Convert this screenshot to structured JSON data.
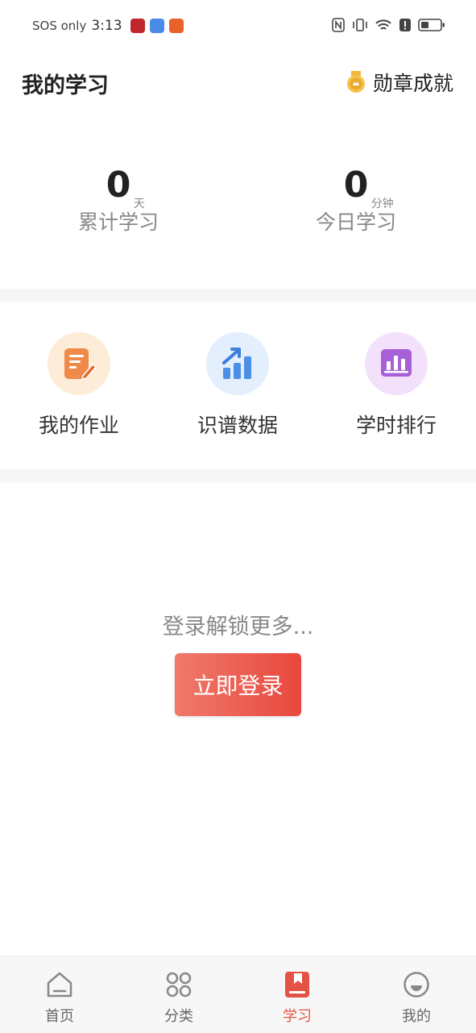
{
  "status_bar": {
    "carrier": "SOS only",
    "time": "3:13",
    "signal_icons": [
      "nfc-icon",
      "vibrate-icon",
      "wifi-icon",
      "alert-icon",
      "battery-icon"
    ]
  },
  "header": {
    "title": "我的学习",
    "badge_label": "勋章成就"
  },
  "stats": [
    {
      "value": "0",
      "unit": "天",
      "label": "累计学习"
    },
    {
      "value": "0",
      "unit": "分钟",
      "label": "今日学习"
    }
  ],
  "features": [
    {
      "label": "我的作业",
      "icon": "homework-icon"
    },
    {
      "label": "识谱数据",
      "icon": "chart-growth-icon"
    },
    {
      "label": "学时排行",
      "icon": "ranking-icon"
    }
  ],
  "login": {
    "hint": "登录解锁更多...",
    "button": "立即登录"
  },
  "tabbar": [
    {
      "label": "首页",
      "icon": "home-icon",
      "active": false
    },
    {
      "label": "分类",
      "icon": "category-icon",
      "active": false
    },
    {
      "label": "学习",
      "icon": "book-icon",
      "active": true
    },
    {
      "label": "我的",
      "icon": "profile-icon",
      "active": false
    }
  ],
  "colors": {
    "accent": "#e45446",
    "button_gradient_start": "#ef7a6c",
    "button_gradient_end": "#e9473d"
  }
}
